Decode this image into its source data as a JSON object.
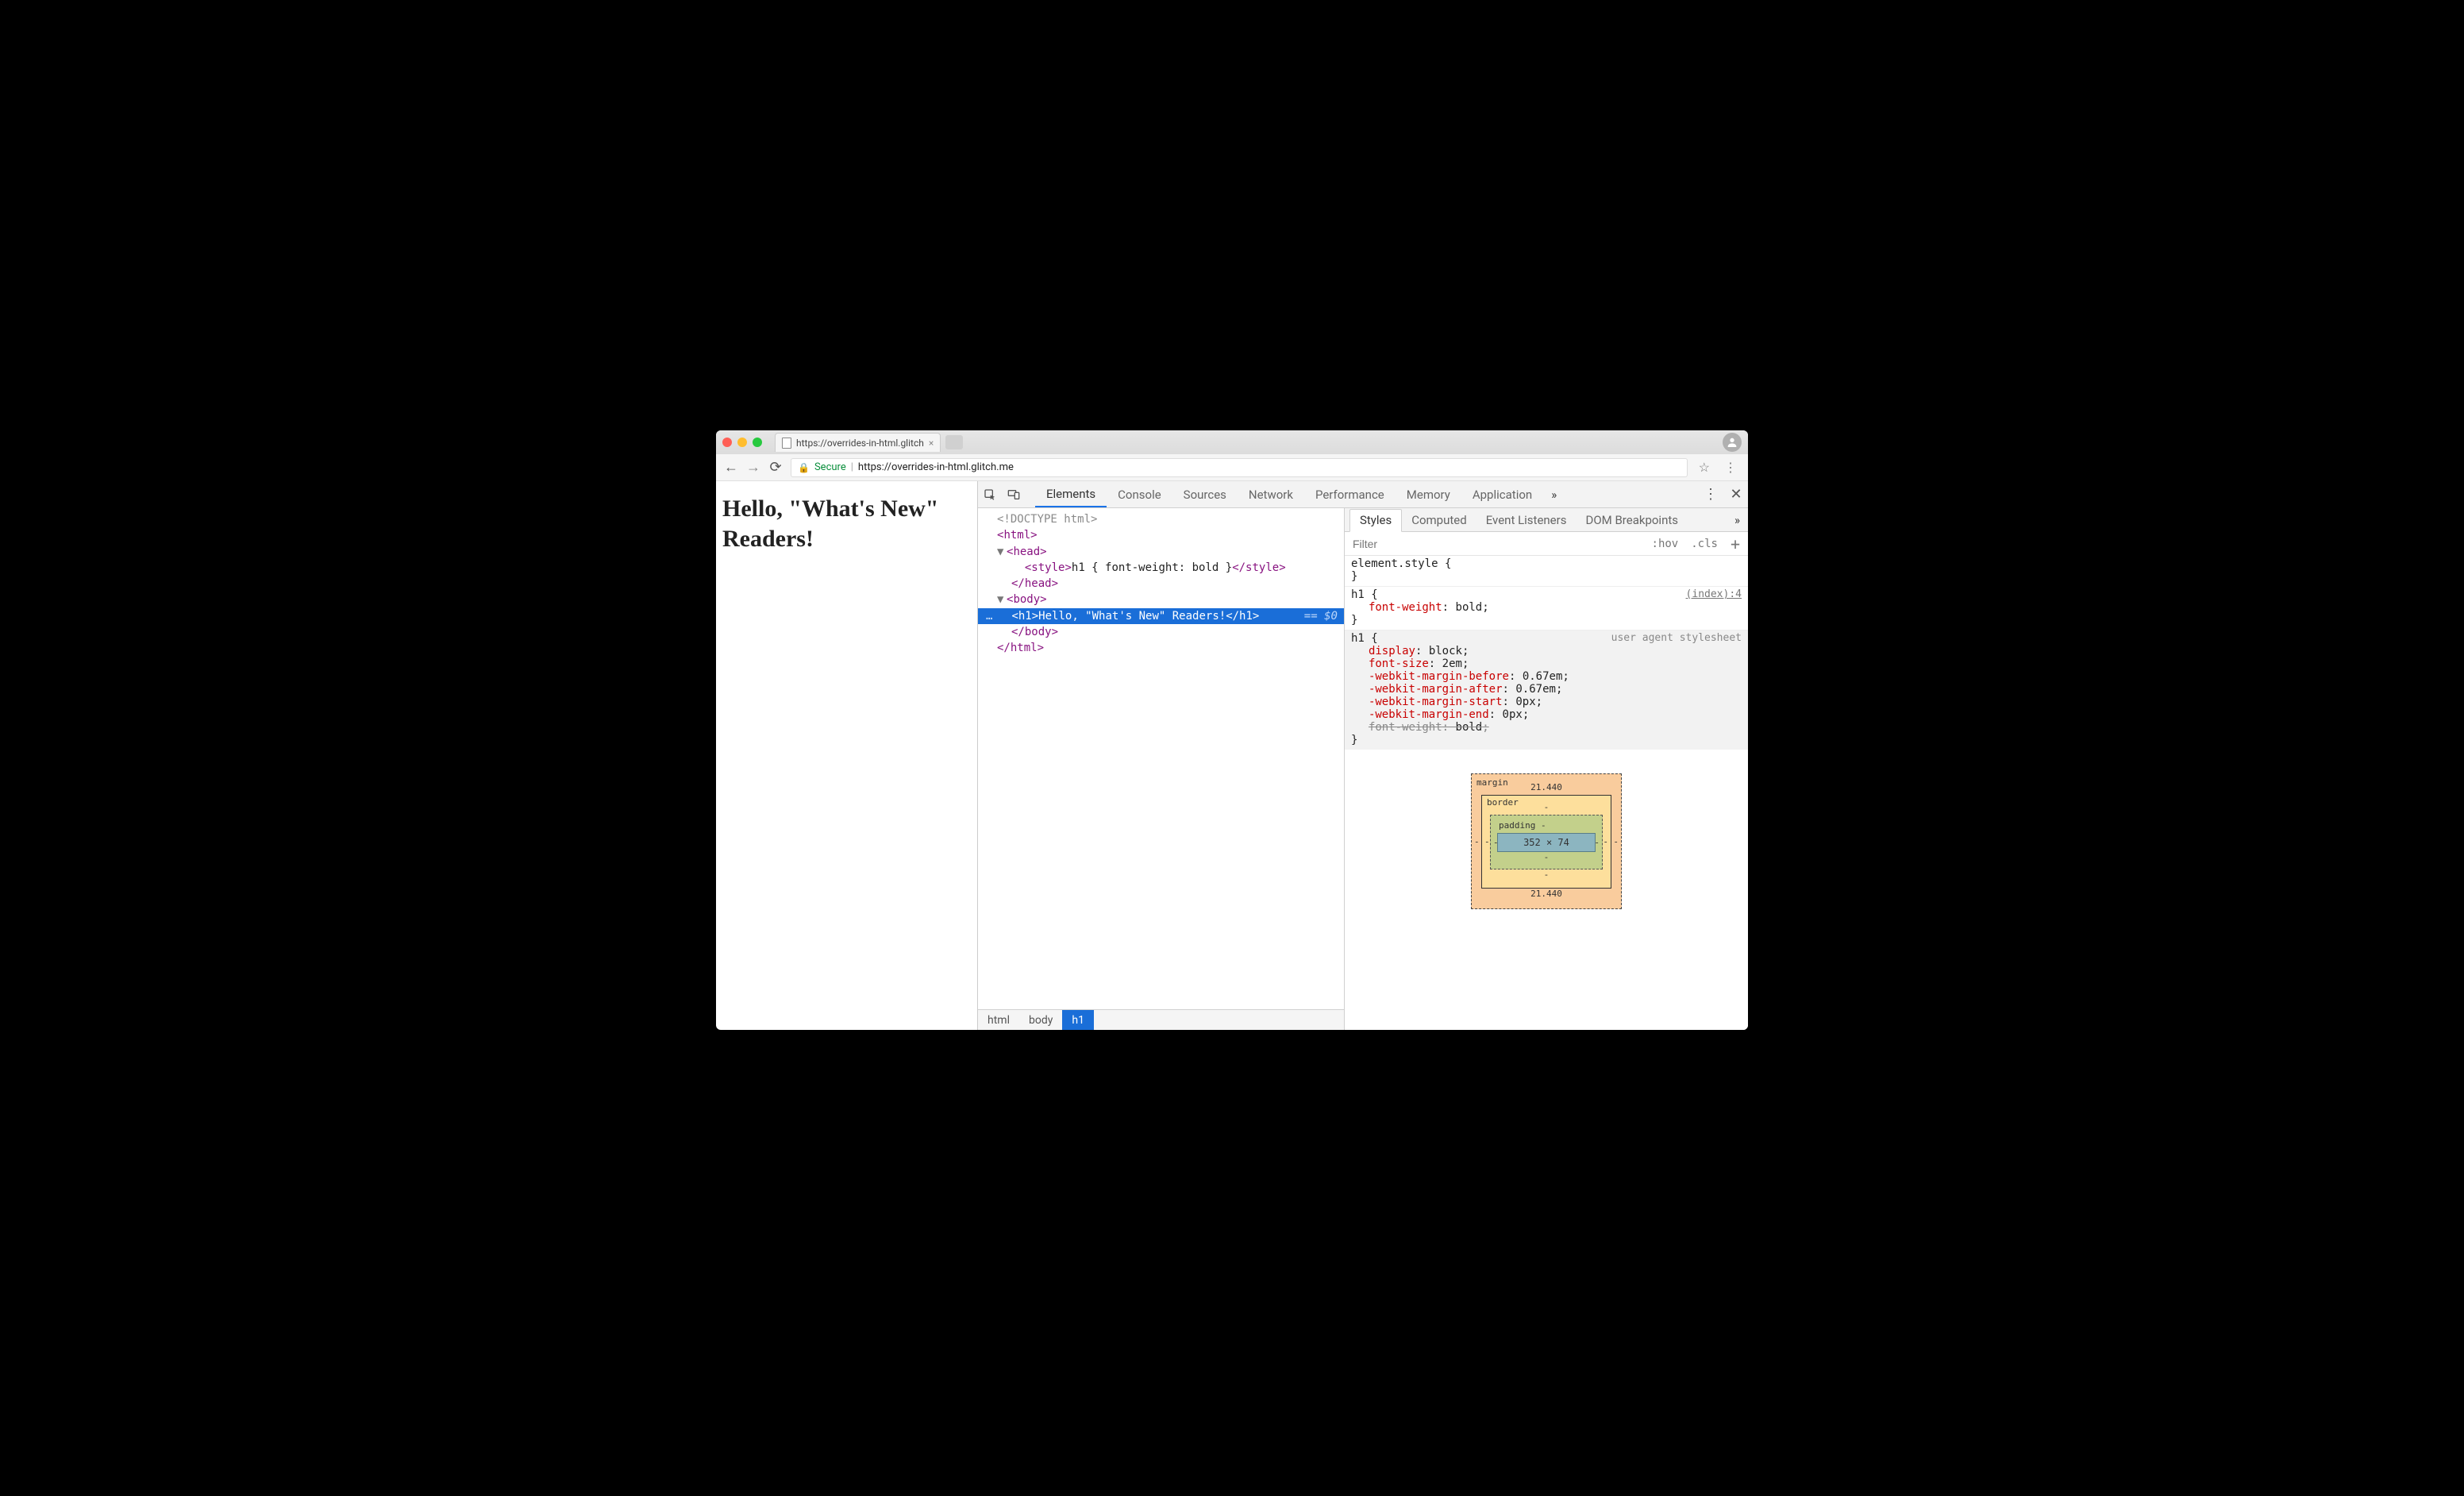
{
  "browser": {
    "tab_title": "https://overrides-in-html.glitch",
    "secure_label": "Secure",
    "url": "https://overrides-in-html.glitch.me"
  },
  "page": {
    "heading": "Hello, \"What's New\" Readers!"
  },
  "devtools": {
    "tabs": [
      "Elements",
      "Console",
      "Sources",
      "Network",
      "Performance",
      "Memory",
      "Application"
    ],
    "breadcrumbs": [
      "html",
      "body",
      "h1"
    ],
    "dom": {
      "doctype": "<!DOCTYPE html>",
      "html_open": "html",
      "head_open": "head",
      "style_open": "style",
      "style_text": "h1 { font-weight: bold }",
      "style_close": "style",
      "head_close": "head",
      "body_open": "body",
      "h1_open": "h1",
      "h1_text": "Hello, \"What's New\" Readers!",
      "h1_close": "h1",
      "body_close": "body",
      "html_close": "html",
      "selected_suffix": "== $0",
      "ellipsis": "…"
    }
  },
  "styles": {
    "tabs": [
      "Styles",
      "Computed",
      "Event Listeners",
      "DOM Breakpoints"
    ],
    "filter_placeholder": "Filter",
    "hov": ":hov",
    "cls": ".cls",
    "rules": {
      "element_style_sel": "element.style {",
      "close": "}",
      "r1_sel": "h1 {",
      "r1_origin": "(index):4",
      "r1_decls": [
        {
          "p": "font-weight",
          "v": "bold"
        }
      ],
      "r2_sel": "h1 {",
      "r2_origin": "user agent stylesheet",
      "r2_decls": [
        {
          "p": "display",
          "v": "block"
        },
        {
          "p": "font-size",
          "v": "2em"
        },
        {
          "p": "-webkit-margin-before",
          "v": "0.67em"
        },
        {
          "p": "-webkit-margin-after",
          "v": "0.67em"
        },
        {
          "p": "-webkit-margin-start",
          "v": "0px"
        },
        {
          "p": "-webkit-margin-end",
          "v": "0px"
        },
        {
          "p": "font-weight",
          "v": "bold",
          "strike": true
        }
      ]
    },
    "boxmodel": {
      "margin_label": "margin",
      "border_label": "border",
      "padding_label": "padding",
      "margin_top": "21.440",
      "margin_bottom": "21.440",
      "border_top": "-",
      "border_bottom": "-",
      "padding_top": "padding -",
      "padding_bottom": "-",
      "dash": "-",
      "content": "352 × 74"
    }
  }
}
